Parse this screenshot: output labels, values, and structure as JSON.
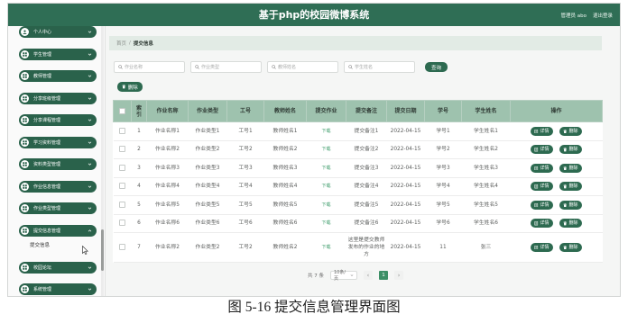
{
  "header": {
    "title": "基于php的校园微博系统",
    "user_label": "管理员 abo",
    "logout_label": "退出登录"
  },
  "sidebar": {
    "items": [
      {
        "label": "个人中心",
        "icon": "user-icon"
      },
      {
        "label": "学生管理",
        "icon": "grid-icon"
      },
      {
        "label": "教师管理",
        "icon": "grid-icon"
      },
      {
        "label": "分享班级管理",
        "icon": "grid-icon"
      },
      {
        "label": "分享课程管理",
        "icon": "grid-icon"
      },
      {
        "label": "学习资料管理",
        "icon": "grid-icon"
      },
      {
        "label": "资料类型管理",
        "icon": "grid-icon"
      },
      {
        "label": "作业信息管理",
        "icon": "grid-icon"
      },
      {
        "label": "作业类型管理",
        "icon": "grid-icon"
      },
      {
        "label": "提交信息管理",
        "icon": "grid-icon",
        "expanded": true,
        "children": [
          {
            "label": "提交信息"
          }
        ]
      },
      {
        "label": "校园论坛",
        "icon": "grid-icon"
      },
      {
        "label": "系统管理",
        "icon": "grid-icon"
      }
    ]
  },
  "breadcrumb": {
    "home": "首页",
    "separator": "/",
    "current": "提交信息"
  },
  "search": {
    "fields": [
      {
        "placeholder": "作业名称"
      },
      {
        "placeholder": "作业类型"
      },
      {
        "placeholder": "教师姓名"
      },
      {
        "placeholder": "学生姓名"
      }
    ],
    "query_label": "查询"
  },
  "toolbar": {
    "delete_label": "删除"
  },
  "table": {
    "columns": [
      "索引",
      "作业名称",
      "作业类型",
      "工号",
      "教师姓名",
      "提交作业",
      "提交备注",
      "提交日期",
      "学号",
      "学生姓名",
      "操作"
    ],
    "rows": [
      [
        "1",
        "作业名称1",
        "作业类型1",
        "工号1",
        "教师姓名1",
        "下载",
        "提交备注1",
        "2022-04-15",
        "学号1",
        "学生姓名1"
      ],
      [
        "2",
        "作业名称2",
        "作业类型2",
        "工号2",
        "教师姓名2",
        "下载",
        "提交备注2",
        "2022-04-15",
        "学号2",
        "学生姓名2"
      ],
      [
        "3",
        "作业名称3",
        "作业类型3",
        "工号3",
        "教师姓名3",
        "下载",
        "提交备注3",
        "2022-04-15",
        "学号3",
        "学生姓名3"
      ],
      [
        "4",
        "作业名称4",
        "作业类型4",
        "工号4",
        "教师姓名4",
        "下载",
        "提交备注4",
        "2022-04-15",
        "学号4",
        "学生姓名4"
      ],
      [
        "5",
        "作业名称5",
        "作业类型5",
        "工号5",
        "教师姓名5",
        "下载",
        "提交备注5",
        "2022-04-15",
        "学号5",
        "学生姓名5"
      ],
      [
        "6",
        "作业名称6",
        "作业类型6",
        "工号6",
        "教师姓名6",
        "下载",
        "提交备注6",
        "2022-04-15",
        "学号6",
        "学生姓名6"
      ],
      [
        "7",
        "作业名称2",
        "作业类型2",
        "工号2",
        "教师姓名2",
        "下载",
        "这里是提交教师发布的作业的地方",
        "2022-04-15",
        "11",
        "张三"
      ]
    ]
  },
  "row_actions": {
    "detail_label": "详情",
    "delete_label": "删除"
  },
  "pagination": {
    "total_label": "共 7 条",
    "page_size_label": "10条/页",
    "current_page": "1"
  },
  "figure": {
    "caption": "图 5-16 提交信息管理界面图"
  },
  "colors": {
    "header": "#2f6e55",
    "sidebar_item": "#2a624b",
    "button": "#2d6a50",
    "table_header": "#9ec2ae",
    "download_link": "#3a9a68",
    "active_page": "#3c8f66"
  }
}
